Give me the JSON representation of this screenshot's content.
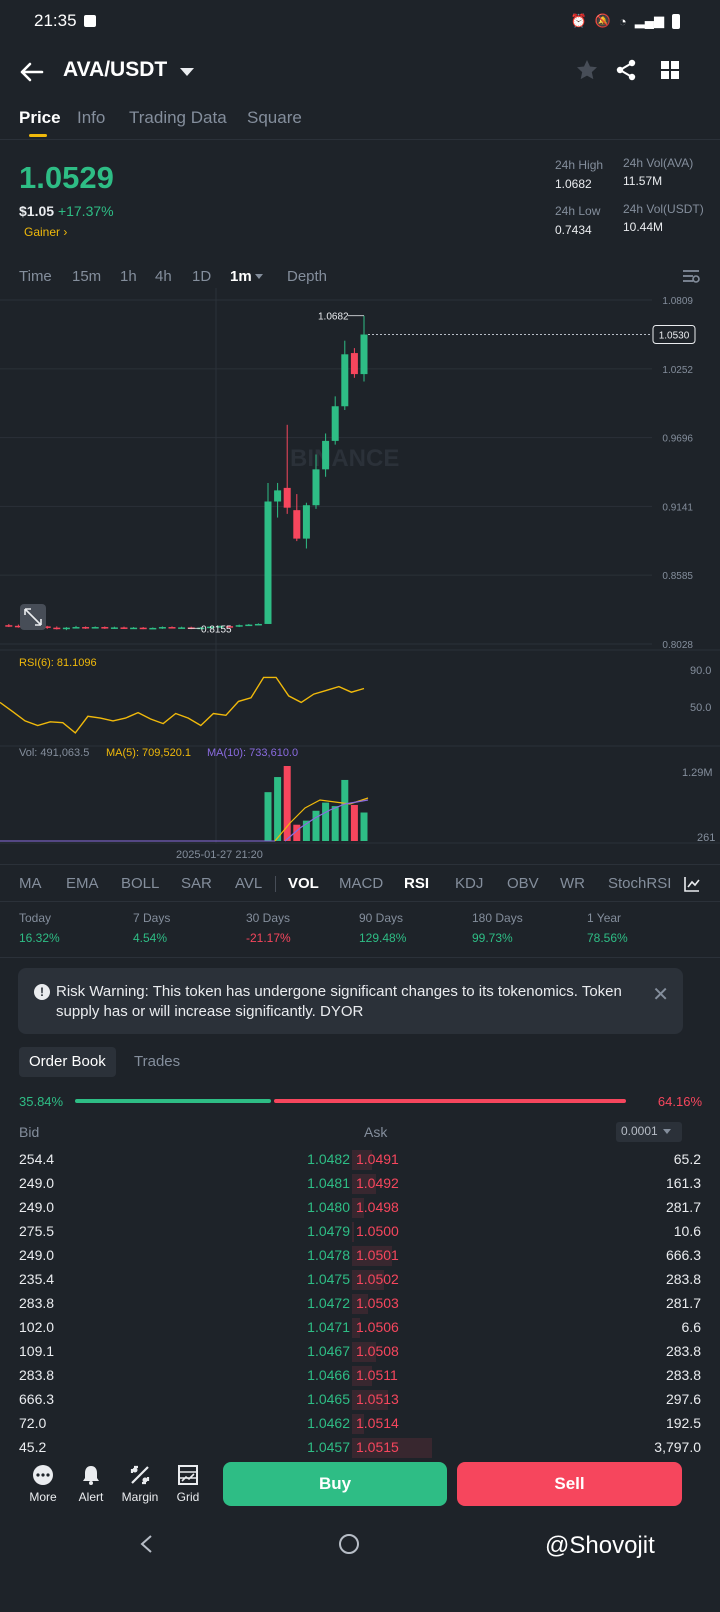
{
  "status_bar": {
    "time": "21:35"
  },
  "header": {
    "pair": "AVA/USDT"
  },
  "tabs": [
    {
      "label": "Price",
      "active": true
    },
    {
      "label": "Info",
      "active": false
    },
    {
      "label": "Trading Data",
      "active": false
    },
    {
      "label": "Square",
      "active": false
    }
  ],
  "price": {
    "last": "1.0529",
    "usd": "$1.05",
    "change": "+17.37%",
    "tag": "Gainer",
    "high_label": "24h High",
    "high": "1.0682",
    "low_label": "24h Low",
    "low": "0.7434",
    "vol_base_label": "24h Vol(AVA)",
    "vol_base": "11.57M",
    "vol_quote_label": "24h Vol(USDT)",
    "vol_quote": "10.44M"
  },
  "intervals": [
    "Time",
    "15m",
    "1h",
    "4h",
    "1D",
    "1m",
    "Depth"
  ],
  "active_interval": "1m",
  "chart_data": {
    "type": "candlestick",
    "y_ticks": [
      "1.0809",
      "1.0252",
      "0.9696",
      "0.9141",
      "0.8585",
      "0.8028"
    ],
    "last_price_label": "1.0530",
    "high_label": "1.0682",
    "low_label": "0.8155",
    "watermark": "BINANCE",
    "ylim": [
      0.8028,
      1.0809
    ],
    "candles": [
      [
        0.818,
        0.8175,
        0.819,
        0.8165
      ],
      [
        0.8175,
        0.817,
        0.8185,
        0.816
      ],
      [
        0.817,
        0.8165,
        0.818,
        0.816
      ],
      [
        0.8165,
        0.817,
        0.818,
        0.8155
      ],
      [
        0.817,
        0.816,
        0.8175,
        0.815
      ],
      [
        0.816,
        0.815,
        0.817,
        0.8145
      ],
      [
        0.815,
        0.816,
        0.8165,
        0.814
      ],
      [
        0.816,
        0.8165,
        0.8175,
        0.8155
      ],
      [
        0.8165,
        0.816,
        0.817,
        0.815
      ],
      [
        0.816,
        0.8165,
        0.817,
        0.8155
      ],
      [
        0.8165,
        0.8158,
        0.817,
        0.815
      ],
      [
        0.8158,
        0.8162,
        0.8168,
        0.815
      ],
      [
        0.8162,
        0.8158,
        0.8168,
        0.815
      ],
      [
        0.8158,
        0.816,
        0.8165,
        0.815
      ],
      [
        0.816,
        0.8155,
        0.8165,
        0.8148
      ],
      [
        0.8155,
        0.8158,
        0.8162,
        0.815
      ],
      [
        0.8158,
        0.8165,
        0.817,
        0.815
      ],
      [
        0.8165,
        0.816,
        0.817,
        0.8155
      ],
      [
        0.816,
        0.8162,
        0.8168,
        0.8155
      ],
      [
        0.8162,
        0.8155,
        0.8168,
        0.8148
      ],
      [
        0.8155,
        0.816,
        0.8165,
        0.815
      ],
      [
        0.816,
        0.8168,
        0.8172,
        0.8155
      ],
      [
        0.8168,
        0.8172,
        0.8178,
        0.8162
      ],
      [
        0.8172,
        0.817,
        0.8178,
        0.8165
      ],
      [
        0.817,
        0.818,
        0.8185,
        0.8165
      ],
      [
        0.818,
        0.8185,
        0.819,
        0.8175
      ],
      [
        0.8185,
        0.819,
        0.8195,
        0.818
      ],
      [
        0.819,
        0.918,
        0.933,
        0.819
      ],
      [
        0.918,
        0.927,
        0.933,
        0.905
      ],
      [
        0.929,
        0.913,
        0.98,
        0.908
      ],
      [
        0.911,
        0.888,
        0.924,
        0.886
      ],
      [
        0.888,
        0.915,
        0.917,
        0.88
      ],
      [
        0.915,
        0.944,
        0.956,
        0.912
      ],
      [
        0.944,
        0.967,
        0.973,
        0.938
      ],
      [
        0.967,
        0.995,
        1.003,
        0.964
      ],
      [
        0.995,
        1.037,
        1.048,
        0.992
      ],
      [
        1.038,
        1.021,
        1.042,
        1.018
      ],
      [
        1.021,
        1.053,
        1.0682,
        1.015
      ]
    ],
    "rsi": {
      "label": "RSI(6): 81.1096",
      "ticks": [
        "90.0",
        "50.0"
      ],
      "values": [
        55,
        45,
        35,
        30,
        34,
        33,
        22,
        40,
        38,
        35,
        38,
        44,
        37,
        32,
        43,
        38,
        30,
        43,
        41,
        56,
        60,
        82,
        82,
        62,
        55,
        64,
        68,
        72,
        66,
        70
      ]
    },
    "volume": {
      "label": "Vol: 491,063.5",
      "ma5_label": "MA(5): 709,520.1",
      "ma10_label": "MA(10): 733,610.0",
      "ticks": [
        "1.29M",
        "261"
      ],
      "timestamp": "2025-01-27 21:20",
      "bars": [
        {
          "v": 0.84,
          "up": true
        },
        {
          "v": 1.1,
          "up": true
        },
        {
          "v": 1.29,
          "up": false
        },
        {
          "v": 0.28,
          "up": false
        },
        {
          "v": 0.35,
          "up": true
        },
        {
          "v": 0.52,
          "up": true
        },
        {
          "v": 0.66,
          "up": true
        },
        {
          "v": 0.6,
          "up": true
        },
        {
          "v": 1.05,
          "up": true
        },
        {
          "v": 0.62,
          "up": false
        },
        {
          "v": 0.49,
          "up": true
        }
      ]
    }
  },
  "indicators": [
    "MA",
    "EMA",
    "BOLL",
    "SAR",
    "AVL",
    "VOL",
    "MACD",
    "RSI",
    "KDJ",
    "OBV",
    "WR",
    "StochRSI"
  ],
  "active_indicators": [
    "VOL",
    "RSI"
  ],
  "performance": [
    {
      "label": "Today",
      "value": "16.32%",
      "up": true
    },
    {
      "label": "7 Days",
      "value": "4.54%",
      "up": true
    },
    {
      "label": "30 Days",
      "value": "-21.17%",
      "up": false
    },
    {
      "label": "90 Days",
      "value": "129.48%",
      "up": true
    },
    {
      "label": "180 Days",
      "value": "99.73%",
      "up": true
    },
    {
      "label": "1 Year",
      "value": "78.56%",
      "up": true
    }
  ],
  "risk_warning": "Risk Warning: This token has undergone significant changes to its tokenomics. Token supply has or will increase significantly. DYOR",
  "order_book": {
    "tabs": [
      "Order Book",
      "Trades"
    ],
    "bid_ratio": "35.84%",
    "ask_ratio": "64.16%",
    "bid_fraction": 0.3584,
    "bid_label": "Bid",
    "ask_label": "Ask",
    "precision": "0.0001",
    "rows": [
      {
        "bq": "254.4",
        "bp": "1.0482",
        "ap": "1.0491",
        "aq": "65.2"
      },
      {
        "bq": "249.0",
        "bp": "1.0481",
        "ap": "1.0492",
        "aq": "161.3"
      },
      {
        "bq": "249.0",
        "bp": "1.0480",
        "ap": "1.0498",
        "aq": "281.7"
      },
      {
        "bq": "275.5",
        "bp": "1.0479",
        "ap": "1.0500",
        "aq": "10.6"
      },
      {
        "bq": "249.0",
        "bp": "1.0478",
        "ap": "1.0501",
        "aq": "666.3"
      },
      {
        "bq": "235.4",
        "bp": "1.0475",
        "ap": "1.0502",
        "aq": "283.8"
      },
      {
        "bq": "283.8",
        "bp": "1.0472",
        "ap": "1.0503",
        "aq": "281.7"
      },
      {
        "bq": "102.0",
        "bp": "1.0471",
        "ap": "1.0506",
        "aq": "6.6"
      },
      {
        "bq": "109.1",
        "bp": "1.0467",
        "ap": "1.0508",
        "aq": "283.8"
      },
      {
        "bq": "283.8",
        "bp": "1.0466",
        "ap": "1.0511",
        "aq": "283.8"
      },
      {
        "bq": "666.3",
        "bp": "1.0465",
        "ap": "1.0513",
        "aq": "297.6"
      },
      {
        "bq": "72.0",
        "bp": "1.0462",
        "ap": "1.0514",
        "aq": "192.5"
      },
      {
        "bq": "45.2",
        "bp": "1.0457",
        "ap": "1.0515",
        "aq": "3,797.0"
      }
    ]
  },
  "actions": {
    "more": "More",
    "alert": "Alert",
    "margin": "Margin",
    "grid": "Grid",
    "buy": "Buy",
    "sell": "Sell"
  },
  "watermark_text": "@Shovojit",
  "colors": {
    "up": "#2ebd85",
    "down": "#f6465d",
    "accent": "#f0b90b",
    "bg": "#1e2329"
  }
}
